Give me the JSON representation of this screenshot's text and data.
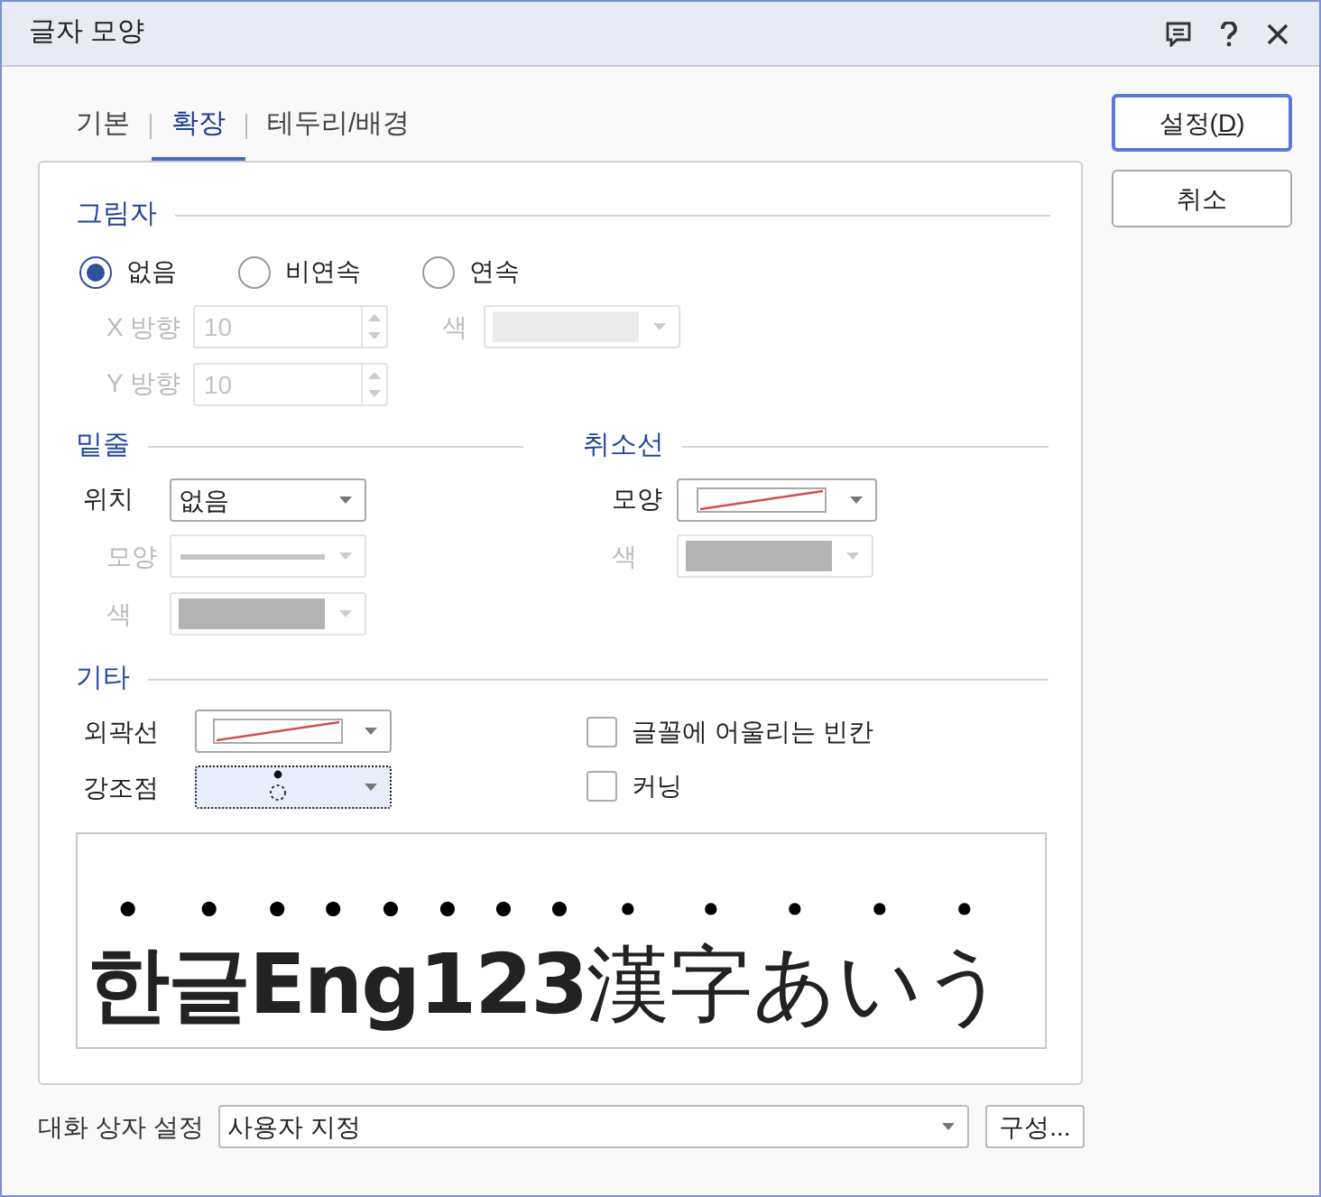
{
  "window": {
    "title": "글자 모양"
  },
  "tabs": [
    {
      "label": "기본",
      "selected": false
    },
    {
      "label": "확장",
      "selected": true
    },
    {
      "label": "테두리/배경",
      "selected": false
    }
  ],
  "buttons": [
    {
      "before": "설정(",
      "key": "D",
      "after": ")",
      "default": true
    },
    {
      "before": "취소",
      "default": false
    }
  ],
  "shadow": {
    "title": "그림자",
    "options": [
      {
        "label": "없음",
        "selected": true
      },
      {
        "label": "비연속",
        "selected": false
      },
      {
        "label": "연속",
        "selected": false
      }
    ],
    "x_label": "X 방향",
    "x_value": "10",
    "y_label": "Y 방향",
    "y_value": "10",
    "color_label": "색",
    "disabled": true
  },
  "underline": {
    "title": "밑줄",
    "position_label": "위치",
    "position": "없음",
    "shape_label": "모양",
    "color_label": "색",
    "disabled": true
  },
  "strikethrough": {
    "title": "취소선",
    "shape_label": "모양",
    "color_label": "색",
    "color_disabled": true
  },
  "other": {
    "title": "기타",
    "outline_label": "외곽선",
    "emphasis_label": "강조점",
    "emphasis_focused": true,
    "checkboxes": [
      {
        "label": "글꼴에 어울리는 빈칸",
        "checked": false
      },
      {
        "label": "커닝",
        "checked": false
      }
    ]
  },
  "preview": {
    "segments": [
      {
        "text": "한글Eng123",
        "kind": "sans"
      },
      {
        "text": "漢字あいう",
        "kind": "serif"
      }
    ],
    "emphasis_dots": true
  },
  "dialog_settings": {
    "label": "대화 상자 설정",
    "value": "사용자 지정",
    "button": "구성..."
  }
}
